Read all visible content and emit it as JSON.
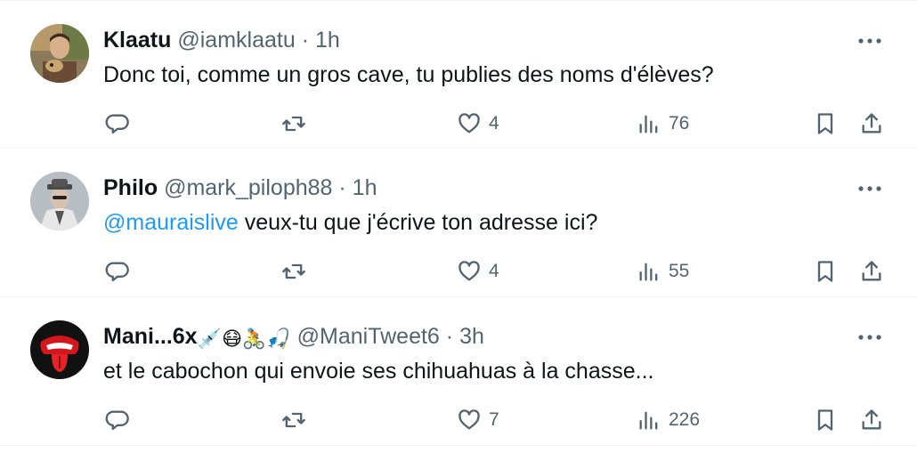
{
  "tweets": [
    {
      "name": "Klaatu",
      "handle": "@iamklaatu",
      "separator": "·",
      "time": "1h",
      "name_emoji": "",
      "text_mention": "",
      "text": "Donc toi, comme un gros cave, tu publies des noms d'élèves?",
      "stats": {
        "replies": "",
        "retweets": "",
        "likes": "4",
        "views": "76"
      },
      "avatar": "klaatu-avatar"
    },
    {
      "name": "Philo",
      "handle": "@mark_piloph88",
      "separator": "·",
      "time": "1h",
      "name_emoji": "",
      "text_mention": "@mauraislive",
      "text": " veux-tu que j'écrive ton adresse ici?",
      "stats": {
        "replies": "",
        "retweets": "",
        "likes": "4",
        "views": "55"
      },
      "avatar": "philo-avatar"
    },
    {
      "name": "Mani...6x",
      "handle": "@ManiTweet6",
      "separator": "·",
      "time": "3h",
      "name_emoji": "💉😷🚴🎣",
      "text_mention": "",
      "text": "et le cabochon qui envoie ses chihuahuas à la chasse...",
      "stats": {
        "replies": "",
        "retweets": "",
        "likes": "7",
        "views": "226"
      },
      "avatar": "rolling-stones-tongue-avatar"
    }
  ],
  "colors": {
    "text": "#0f1419",
    "secondary": "#536471",
    "link": "#1d9bf0",
    "border": "#eff3f4"
  },
  "icons": [
    "reply-icon",
    "retweet-icon",
    "like-icon",
    "views-icon",
    "bookmark-icon",
    "share-icon",
    "more-icon"
  ]
}
